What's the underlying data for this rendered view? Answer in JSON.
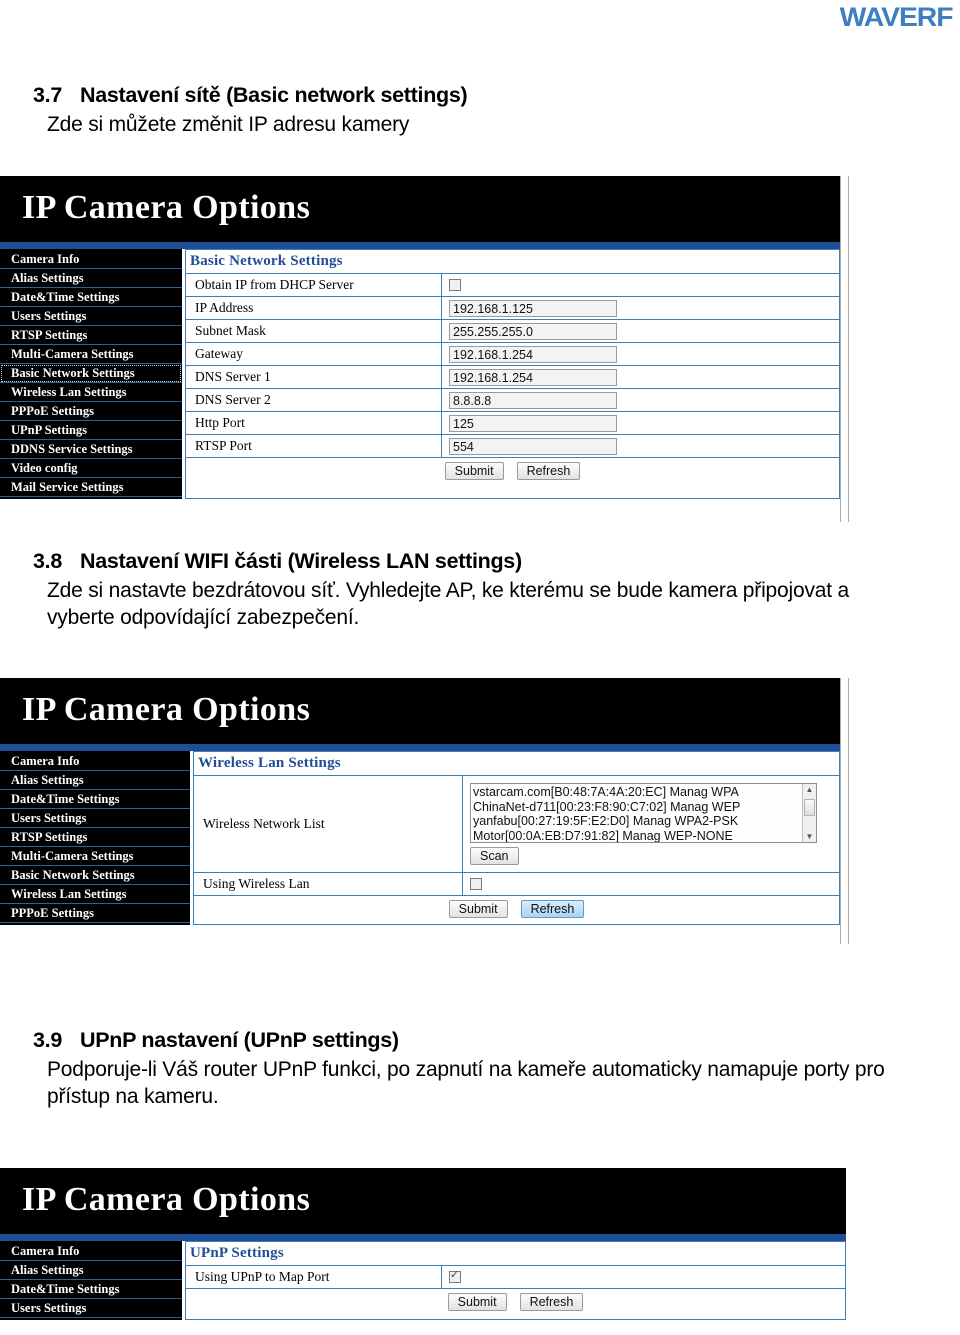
{
  "brand": {
    "logo_text": "WAVERF",
    "accent_color": "#3d7fc1"
  },
  "sections": [
    {
      "number": "3.7",
      "title": "Nastavení sítě (Basic network settings)",
      "body": "Zde si můžete změnit IP adresu kamery"
    },
    {
      "number": "3.8",
      "title": "Nastavení WIFI části (Wireless LAN settings)",
      "body": "Zde si nastavte bezdrátovou síť. Vyhledejte AP, ke kterému se bude kamera připojovat a vyberte odpovídající zabezpečení."
    },
    {
      "number": "3.9",
      "title": "UPnP nastavení (UPnP settings)",
      "body": "Podporuje-li Váš router UPnP funkci, po zapnutí na kameře automaticky namapuje porty pro přístup na kameru."
    }
  ],
  "panel1": {
    "header_title": "IP Camera Options",
    "menu": [
      "Camera Info",
      "Alias Settings",
      "Date&Time Settings",
      "Users Settings",
      "RTSP Settings",
      "Multi-Camera Settings",
      "Basic Network Settings",
      "Wireless Lan Settings",
      "PPPoE Settings",
      "UPnP Settings",
      "DDNS Service Settings",
      "Video config",
      "Mail Service Settings"
    ],
    "selected_menu": "Basic Network Settings",
    "content_title": "Basic Network Settings",
    "rows": [
      {
        "label": "Obtain IP from DHCP Server",
        "type": "checkbox",
        "checked": false
      },
      {
        "label": "IP Address",
        "type": "text",
        "value": "192.168.1.125"
      },
      {
        "label": "Subnet Mask",
        "type": "text",
        "value": "255.255.255.0"
      },
      {
        "label": "Gateway",
        "type": "text",
        "value": "192.168.1.254"
      },
      {
        "label": "DNS Server 1",
        "type": "text",
        "value": "192.168.1.254"
      },
      {
        "label": "DNS Server 2",
        "type": "text",
        "value": "8.8.8.8"
      },
      {
        "label": "Http Port",
        "type": "text",
        "value": "125"
      },
      {
        "label": "RTSP Port",
        "type": "text",
        "value": "554"
      }
    ],
    "submit_label": "Submit",
    "refresh_label": "Refresh"
  },
  "panel2": {
    "header_title": "IP Camera Options",
    "menu": [
      "Camera Info",
      "Alias Settings",
      "Date&Time Settings",
      "Users Settings",
      "RTSP Settings",
      "Multi-Camera Settings",
      "Basic Network Settings",
      "Wireless Lan Settings",
      "PPPoE Settings"
    ],
    "content_title": "Wireless Lan Settings",
    "network_list_label": "Wireless Network List",
    "networks": [
      "vstarcam.com[B0:48:7A:4A:20:EC] Manag WPA",
      "ChinaNet-d711[00:23:F8:90:C7:02] Manag WEP",
      "yanfabu[00:27:19:5F:E2:D0] Manag WPA2-PSK",
      "Motor[00:0A:EB:D7:91:82] Manag WEP-NONE"
    ],
    "scan_label": "Scan",
    "using_wireless_label": "Using Wireless Lan",
    "using_wireless_checked": false,
    "submit_label": "Submit",
    "refresh_label": "Refresh"
  },
  "panel3": {
    "header_title": "IP Camera Options",
    "menu": [
      "Camera Info",
      "Alias Settings",
      "Date&Time Settings",
      "Users Settings"
    ],
    "content_title": "UPnP Settings",
    "rows": [
      {
        "label": "Using UPnP to Map Port",
        "type": "checkbox",
        "checked": true
      }
    ],
    "submit_label": "Submit",
    "refresh_label": "Refresh"
  }
}
